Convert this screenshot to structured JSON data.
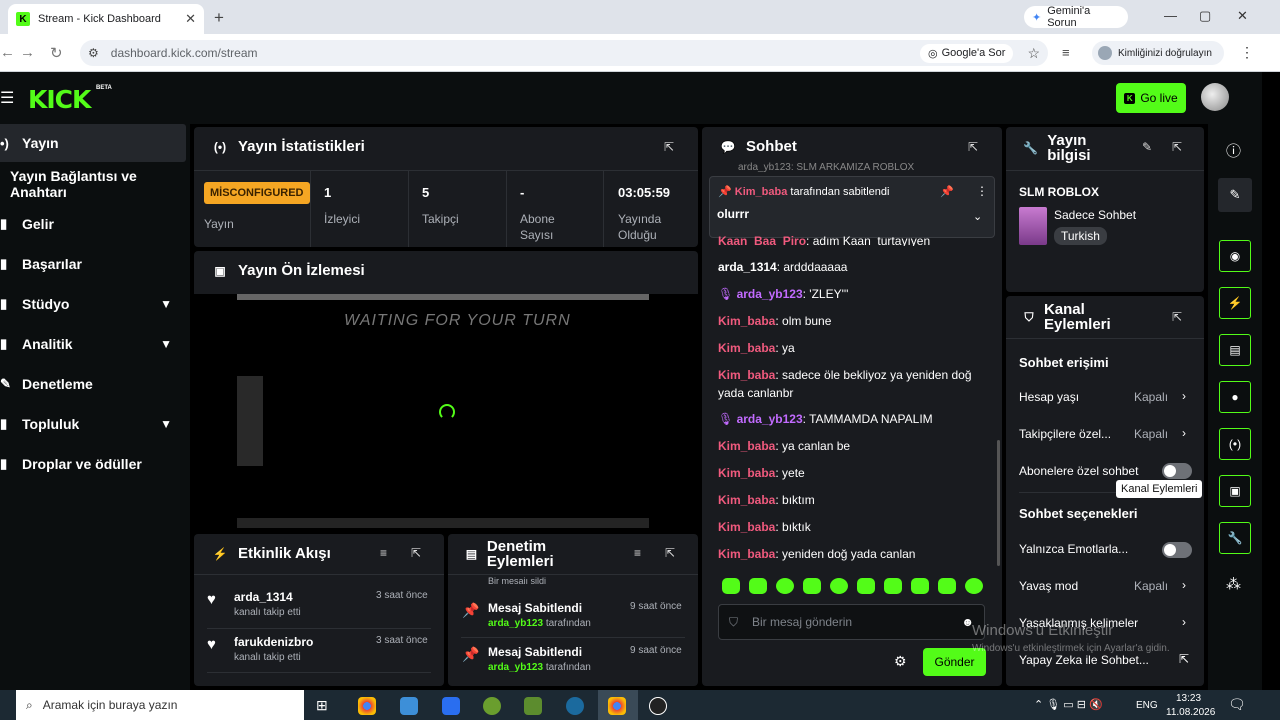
{
  "browser": {
    "tab_title": "Stream - Kick Dashboard",
    "tab_fav": "K",
    "gemini": "Gemini'a Sorun",
    "url": "dashboard.kick.com/stream",
    "google_ask": "Google'a Sor",
    "verify": "Kimliğinizi doğrulayın"
  },
  "header": {
    "logo": "KICK",
    "beta": "BETA",
    "go_live": "Go live"
  },
  "sidebar": {
    "items": [
      {
        "label": "Yayın",
        "icon": "broadcast-icon"
      },
      {
        "label": "Yayın Bağlantısı ve Anahtarı"
      },
      {
        "label": "Gelir",
        "icon": "chart-icon"
      },
      {
        "label": "Başarılar",
        "icon": "trophy-icon"
      },
      {
        "label": "Stüdyo",
        "icon": "studio-icon"
      },
      {
        "label": "Analitik",
        "icon": "analytics-icon"
      },
      {
        "label": "Denetleme",
        "icon": "wrench-icon"
      },
      {
        "label": "Topluluk",
        "icon": "community-icon"
      },
      {
        "label": "Droplar ve ödüller",
        "icon": "gift-icon"
      }
    ]
  },
  "stats": {
    "title": "Yayın İstatistikleri",
    "status_badge": "MİSCONFIGURED",
    "status_label": "Yayın",
    "viewers": "1",
    "viewers_label": "İzleyici",
    "followers": "5",
    "followers_label": "Takipçi",
    "subs": "-",
    "subs_label": "Abone Sayısı",
    "uptime": "03:05:59",
    "uptime_label": "Yayında Olduğu"
  },
  "preview": {
    "title": "Yayın Ön İzlemesi",
    "overlay_text": "WAITING FOR YOUR TURN"
  },
  "activity": {
    "title": "Etkinlik Akışı",
    "items": [
      {
        "user": "arda_1314",
        "action": "kanalı takip etti",
        "time": "3 saat önce"
      },
      {
        "user": "farukdenizbro",
        "action": "kanalı takip etti",
        "time": "3 saat önce"
      }
    ]
  },
  "moderation": {
    "title": "Denetim Eylemleri",
    "peek": "Bir mesajı sildi",
    "items": [
      {
        "title": "Mesaj Sabitlendi",
        "user": "arda_yb123",
        "suffix": "tarafından",
        "time": "9 saat önce"
      },
      {
        "title": "Mesaj Sabitlendi",
        "user": "arda_yb123",
        "suffix": "tarafından",
        "time": "9 saat önce"
      }
    ]
  },
  "chat": {
    "title": "Sohbet",
    "pinned_by_user": "Kim_baba",
    "pinned_by_suffix": "tarafından sabitlendi",
    "pinned_msg": "olurrr",
    "top_line": "arda_yb123: SLM ARKAMIZA ROBLOX",
    "partial_line_user": "Kaan_Baa_Piro",
    "partial_line_text": ": adım Kaan_turtayıyen",
    "messages": [
      {
        "user": "arda_1314",
        "text": ": ardddaaaaa",
        "style": "white"
      },
      {
        "user": "arda_yb123",
        "text": ": 'ZLEY'''",
        "style": "purple"
      },
      {
        "user": "Kim_baba",
        "text": ": olm bune",
        "style": "red"
      },
      {
        "user": "Kim_baba",
        "text": ": ya",
        "style": "red"
      },
      {
        "user": "Kim_baba",
        "text": ": sadece öle bekliyoz ya yeniden doğ yada canlanbr",
        "style": "red"
      },
      {
        "user": "arda_yb123",
        "text": ": TAMMAMDA NAPALIM",
        "style": "purple"
      },
      {
        "user": "Kim_baba",
        "text": ": ya canlan be",
        "style": "red"
      },
      {
        "user": "Kim_baba",
        "text": ": yete",
        "style": "red"
      },
      {
        "user": "Kim_baba",
        "text": ": bıktım",
        "style": "red"
      },
      {
        "user": "Kim_baba",
        "text": ": bıktık",
        "style": "red"
      },
      {
        "user": "Kim_baba",
        "text": ": yeniden doğ yada canlan",
        "style": "red"
      }
    ],
    "input_placeholder": "Bir mesaj gönderin",
    "send": "Gönder"
  },
  "stream_info": {
    "title": "Yayın bilgisi",
    "stream_title": "SLM ROBLOX",
    "category": "Sadece Sohbet",
    "language": "Turkish"
  },
  "channel_actions": {
    "title": "Kanal Eylemleri",
    "chat_access": "Sohbet erişimi",
    "rows": [
      {
        "label": "Hesap yaşı",
        "value": "Kapalı"
      },
      {
        "label": "Takipçilere özel...",
        "value": "Kapalı"
      }
    ],
    "subs_only": "Abonelere özel sohbet",
    "chat_options": "Sohbet seçenekleri",
    "emotes_only": "Yalnızca Emotlarla...",
    "slow_mode": "Yavaş mod",
    "slow_value": "Kapalı",
    "banned_words": "Yasaklanmış kelimeler",
    "ai_chat": "Yapay Zeka ile Sohbet...",
    "tooltip": "Kanal Eylemleri"
  },
  "watermark": {
    "line1": "Windows'u Etkinleştir",
    "line2": "Windows'u etkinleştirmek için Ayarlar'a gidin."
  },
  "taskbar": {
    "search": "Aramak için buraya yazın",
    "lang": "ENG",
    "time": "13:23",
    "date": "11.08.2026"
  }
}
